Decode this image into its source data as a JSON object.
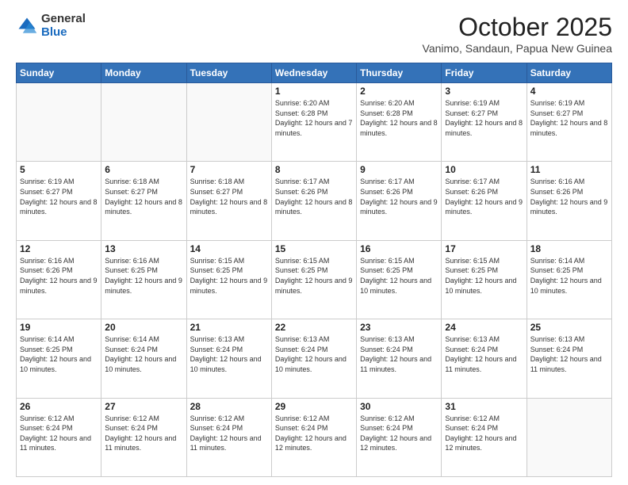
{
  "header": {
    "logo_general": "General",
    "logo_blue": "Blue",
    "month_title": "October 2025",
    "location": "Vanimo, Sandaun, Papua New Guinea"
  },
  "weekdays": [
    "Sunday",
    "Monday",
    "Tuesday",
    "Wednesday",
    "Thursday",
    "Friday",
    "Saturday"
  ],
  "weeks": [
    [
      {
        "day": "",
        "info": ""
      },
      {
        "day": "",
        "info": ""
      },
      {
        "day": "",
        "info": ""
      },
      {
        "day": "1",
        "info": "Sunrise: 6:20 AM\nSunset: 6:28 PM\nDaylight: 12 hours and 7 minutes."
      },
      {
        "day": "2",
        "info": "Sunrise: 6:20 AM\nSunset: 6:28 PM\nDaylight: 12 hours and 8 minutes."
      },
      {
        "day": "3",
        "info": "Sunrise: 6:19 AM\nSunset: 6:27 PM\nDaylight: 12 hours and 8 minutes."
      },
      {
        "day": "4",
        "info": "Sunrise: 6:19 AM\nSunset: 6:27 PM\nDaylight: 12 hours and 8 minutes."
      }
    ],
    [
      {
        "day": "5",
        "info": "Sunrise: 6:19 AM\nSunset: 6:27 PM\nDaylight: 12 hours and 8 minutes."
      },
      {
        "day": "6",
        "info": "Sunrise: 6:18 AM\nSunset: 6:27 PM\nDaylight: 12 hours and 8 minutes."
      },
      {
        "day": "7",
        "info": "Sunrise: 6:18 AM\nSunset: 6:27 PM\nDaylight: 12 hours and 8 minutes."
      },
      {
        "day": "8",
        "info": "Sunrise: 6:17 AM\nSunset: 6:26 PM\nDaylight: 12 hours and 8 minutes."
      },
      {
        "day": "9",
        "info": "Sunrise: 6:17 AM\nSunset: 6:26 PM\nDaylight: 12 hours and 9 minutes."
      },
      {
        "day": "10",
        "info": "Sunrise: 6:17 AM\nSunset: 6:26 PM\nDaylight: 12 hours and 9 minutes."
      },
      {
        "day": "11",
        "info": "Sunrise: 6:16 AM\nSunset: 6:26 PM\nDaylight: 12 hours and 9 minutes."
      }
    ],
    [
      {
        "day": "12",
        "info": "Sunrise: 6:16 AM\nSunset: 6:26 PM\nDaylight: 12 hours and 9 minutes."
      },
      {
        "day": "13",
        "info": "Sunrise: 6:16 AM\nSunset: 6:25 PM\nDaylight: 12 hours and 9 minutes."
      },
      {
        "day": "14",
        "info": "Sunrise: 6:15 AM\nSunset: 6:25 PM\nDaylight: 12 hours and 9 minutes."
      },
      {
        "day": "15",
        "info": "Sunrise: 6:15 AM\nSunset: 6:25 PM\nDaylight: 12 hours and 9 minutes."
      },
      {
        "day": "16",
        "info": "Sunrise: 6:15 AM\nSunset: 6:25 PM\nDaylight: 12 hours and 10 minutes."
      },
      {
        "day": "17",
        "info": "Sunrise: 6:15 AM\nSunset: 6:25 PM\nDaylight: 12 hours and 10 minutes."
      },
      {
        "day": "18",
        "info": "Sunrise: 6:14 AM\nSunset: 6:25 PM\nDaylight: 12 hours and 10 minutes."
      }
    ],
    [
      {
        "day": "19",
        "info": "Sunrise: 6:14 AM\nSunset: 6:25 PM\nDaylight: 12 hours and 10 minutes."
      },
      {
        "day": "20",
        "info": "Sunrise: 6:14 AM\nSunset: 6:24 PM\nDaylight: 12 hours and 10 minutes."
      },
      {
        "day": "21",
        "info": "Sunrise: 6:13 AM\nSunset: 6:24 PM\nDaylight: 12 hours and 10 minutes."
      },
      {
        "day": "22",
        "info": "Sunrise: 6:13 AM\nSunset: 6:24 PM\nDaylight: 12 hours and 10 minutes."
      },
      {
        "day": "23",
        "info": "Sunrise: 6:13 AM\nSunset: 6:24 PM\nDaylight: 12 hours and 11 minutes."
      },
      {
        "day": "24",
        "info": "Sunrise: 6:13 AM\nSunset: 6:24 PM\nDaylight: 12 hours and 11 minutes."
      },
      {
        "day": "25",
        "info": "Sunrise: 6:13 AM\nSunset: 6:24 PM\nDaylight: 12 hours and 11 minutes."
      }
    ],
    [
      {
        "day": "26",
        "info": "Sunrise: 6:12 AM\nSunset: 6:24 PM\nDaylight: 12 hours and 11 minutes."
      },
      {
        "day": "27",
        "info": "Sunrise: 6:12 AM\nSunset: 6:24 PM\nDaylight: 12 hours and 11 minutes."
      },
      {
        "day": "28",
        "info": "Sunrise: 6:12 AM\nSunset: 6:24 PM\nDaylight: 12 hours and 11 minutes."
      },
      {
        "day": "29",
        "info": "Sunrise: 6:12 AM\nSunset: 6:24 PM\nDaylight: 12 hours and 12 minutes."
      },
      {
        "day": "30",
        "info": "Sunrise: 6:12 AM\nSunset: 6:24 PM\nDaylight: 12 hours and 12 minutes."
      },
      {
        "day": "31",
        "info": "Sunrise: 6:12 AM\nSunset: 6:24 PM\nDaylight: 12 hours and 12 minutes."
      },
      {
        "day": "",
        "info": ""
      }
    ]
  ]
}
